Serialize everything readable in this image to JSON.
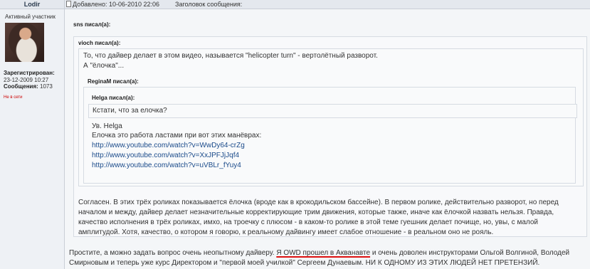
{
  "header": {
    "username": "Lodir",
    "posted_label": "Добавлено: 10-06-2010 22:06",
    "subject_label": "Заголовок сообщения:"
  },
  "user": {
    "rank": "Активный участник",
    "registered_label": "Зарегистрирован:",
    "registered_date": "23-12-2009 10:27",
    "messages_label": "Сообщения:",
    "messages_count": "1073",
    "status": "Не в сети"
  },
  "quotes": {
    "sns_title": "sns писал(а):",
    "vioch_title": "vioch писал(а):",
    "vioch_line1": "То, что дайвер делает в этом видео, называется \"helicopter turn\" - вертолётный разворот.",
    "vioch_line2": "А \"ёлочка\"...",
    "regina_title": "ReginaM писал(а):",
    "helga_title": "Helga писал(а):",
    "helga_text": "Кстати, что за елочка?",
    "regina_line1": "Ув. Helga",
    "regina_line2": "Елочка это работа ластами при вот этих манёврах:",
    "links": [
      "http://www.youtube.com/watch?v=WwDy64-crZg",
      "http://www.youtube.com/watch?v=XxJPFJjJqf4",
      "http://www.youtube.com/watch?v=uVBLr_fYuy4"
    ],
    "sns_para_line1": "Согласен. В этих трёх роликах показывается ёлочка (вроде как в крокодильском бассейне). В первом ролике, действительно разворот, но перед",
    "sns_para_line2": "началом и между, дайвер делает незначительные корректирующие трим движения, которые также, иначе как ёлочкой назвать нельзя. Правда,",
    "sns_para_line3": "качество исполнения в трёх роликах, имхо, на троечку с плюсом - в каком-то ролике в этой теме гуешник делает почище, но, увы, с малой",
    "sns_para_line4": "амплитудой. Хотя, качество, о котором я говорю, к реальному дайвингу имеет слабое отношение - в реальном оно не рояль."
  },
  "reply": {
    "line1_before": "Простите, а можно задать вопрос очень неопытному дайверу. ",
    "line1_highlight": "Я OWD прошел в Акванавте",
    "line1_after": " и очень доволен инструкторами Ольгой Волгиной, Володей",
    "line2": "Смирновым и теперь уже курс Директором и \"первой моей училкой\" Сергеем Дунаевым. НИ К ОДНОМУ ИЗ ЭТИХ ЛЮДЕЙ НЕТ ПРЕТЕНЗИЙ."
  }
}
